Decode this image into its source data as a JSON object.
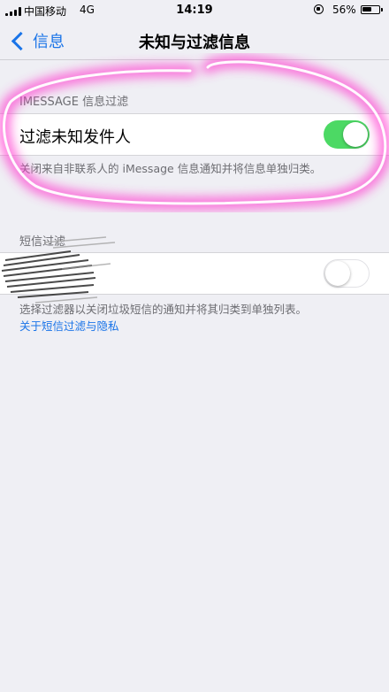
{
  "status_bar": {
    "carrier": "中国移动",
    "network": "4G",
    "time": "14:19",
    "battery_percent": "56%",
    "battery_level": 0.56
  },
  "nav": {
    "back_label": "信息",
    "title": "未知与过滤信息"
  },
  "imessage_section": {
    "header": "IMESSAGE 信息过滤",
    "toggle_label": "过滤未知发件人",
    "toggle_on": true,
    "footer": "关闭来自非联系人的 iMessage 信息通知并将信息单独归类。"
  },
  "sms_section": {
    "header": "短信过滤",
    "toggle_on": false,
    "footer": "选择过滤器以关闭垃圾短信的通知并将其归类到单独列表。",
    "link": "关于短信过滤与隐私"
  },
  "colors": {
    "accent": "#1a74e8",
    "toggle_on": "#4cd964",
    "highlight": "#ff3fd0"
  },
  "icons": {
    "back": "chevron-left-icon",
    "rotation_lock": "rotation-lock-icon",
    "battery": "battery-icon",
    "signal": "signal-bars-icon"
  }
}
